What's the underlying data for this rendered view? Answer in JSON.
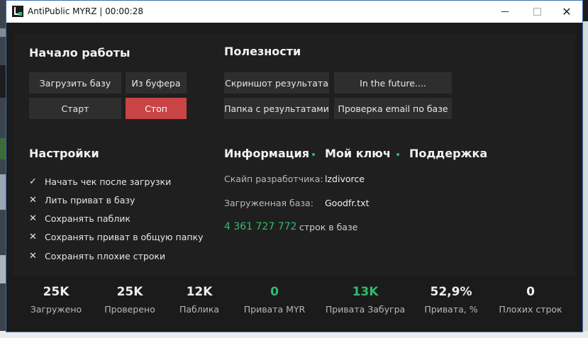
{
  "window": {
    "title": "AntiPublic MYRZ | 00:00:28",
    "close_glyph": "✕"
  },
  "start": {
    "heading": "Начало работы",
    "load_base": "Загрузить базу",
    "from_clipboard": "Из буфера",
    "start": "Старт",
    "stop": "Стоп"
  },
  "utilities": {
    "heading": "Полезности",
    "screenshot": "Скриншот результата",
    "future": "In the future....",
    "results_folder": "Папка с результатами",
    "check_email": "Проверка email по базе"
  },
  "settings": {
    "heading": "Настройки",
    "options": [
      {
        "mark": "✓",
        "label": "Начать чек после загрузки"
      },
      {
        "mark": "✕",
        "label": "Лить приват в базу"
      },
      {
        "mark": "✕",
        "label": "Сохранять паблик"
      },
      {
        "mark": "✕",
        "label": "Сохранять приват в общую папку"
      },
      {
        "mark": "✕",
        "label": "Сохранять плохие строки"
      }
    ]
  },
  "info": {
    "tabs": [
      "Информация",
      "Мой ключ",
      "Поддержка"
    ],
    "skype_label": "Скайп разработчика:",
    "skype_value": "lzdivorce",
    "base_label": "Загруженная база:",
    "base_value": "Goodfr.txt",
    "lines_count": "4 361 727 772",
    "lines_suffix": "строк в базе",
    "accent_color": "#2dbd6e"
  },
  "stats": [
    {
      "value": "25K",
      "label": "Загружено"
    },
    {
      "value": "25K",
      "label": "Проверено"
    },
    {
      "value": "12K",
      "label": "Паблика"
    },
    {
      "value": "0",
      "label": "Привата MYR"
    },
    {
      "value": "13K",
      "label": "Привата Забугра"
    },
    {
      "value": "52,9%",
      "label": "Привата, %"
    },
    {
      "value": "0",
      "label": "Плохих строк"
    }
  ]
}
